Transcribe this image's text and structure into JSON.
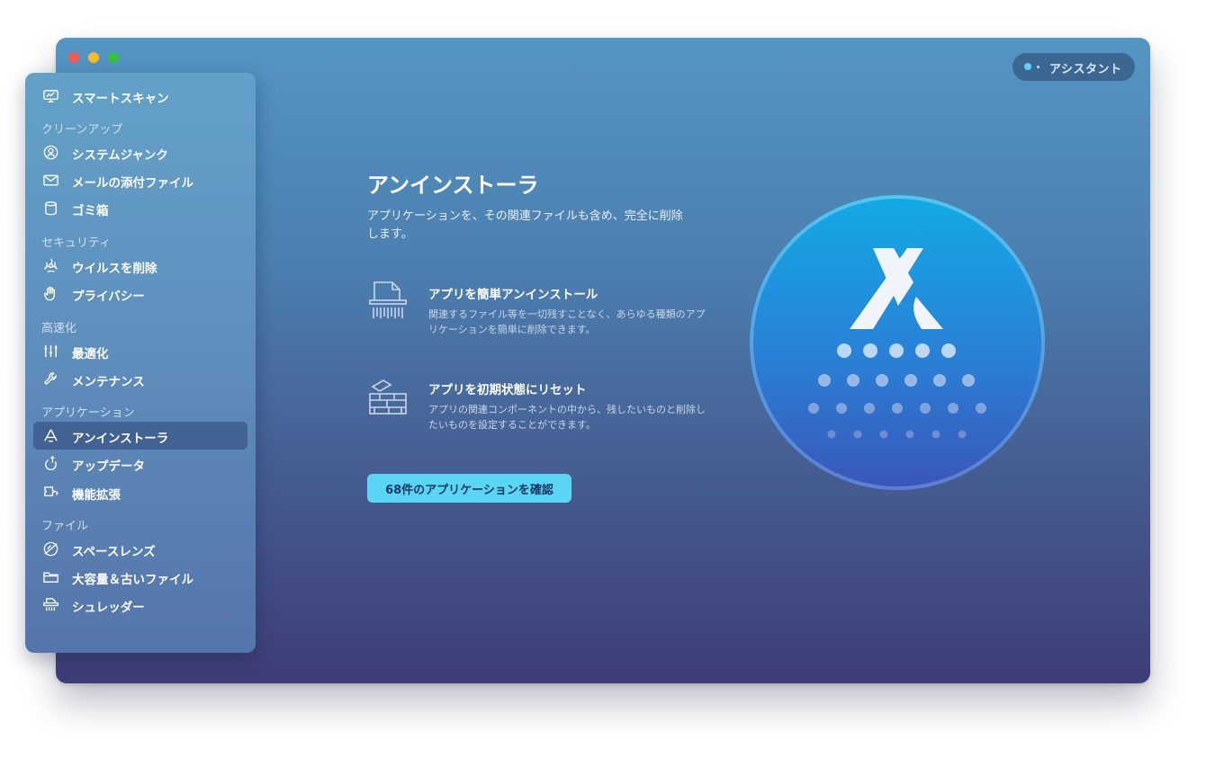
{
  "window": {
    "title": ""
  },
  "assistant": {
    "label": "アシスタント"
  },
  "sidebar": {
    "top_item": {
      "label": "スマートスキャン",
      "icon": "smart-scan-icon"
    },
    "sections": [
      {
        "heading": "クリーンアップ",
        "items": [
          {
            "label": "システムジャンク",
            "icon": "system-junk-icon"
          },
          {
            "label": "メールの添付ファイル",
            "icon": "mail-icon"
          },
          {
            "label": "ゴミ箱",
            "icon": "trash-icon"
          }
        ]
      },
      {
        "heading": "セキュリティ",
        "items": [
          {
            "label": "ウイルスを削除",
            "icon": "biohazard-icon"
          },
          {
            "label": "プライバシー",
            "icon": "hand-icon"
          }
        ]
      },
      {
        "heading": "高速化",
        "items": [
          {
            "label": "最適化",
            "icon": "sliders-icon"
          },
          {
            "label": "メンテナンス",
            "icon": "wrench-icon"
          }
        ]
      },
      {
        "heading": "アプリケーション",
        "items": [
          {
            "label": "アンインストーラ",
            "icon": "uninstaller-icon",
            "active": true
          },
          {
            "label": "アップデータ",
            "icon": "updater-icon"
          },
          {
            "label": "機能拡張",
            "icon": "extensions-icon"
          }
        ]
      },
      {
        "heading": "ファイル",
        "items": [
          {
            "label": "スペースレンズ",
            "icon": "space-lens-icon"
          },
          {
            "label": "大容量＆古いファイル",
            "icon": "folder-icon"
          },
          {
            "label": "シュレッダー",
            "icon": "shredder-icon"
          }
        ]
      }
    ]
  },
  "main": {
    "title": "アンインストーラ",
    "description": "アプリケーションを、その関連ファイルも含め、完全に削除します。",
    "features": [
      {
        "title": "アプリを簡単アンインストール",
        "description": "関連するファイル等を一切残すことなく、あらゆる種類のアプリケーションを簡単に削除できます。",
        "icon": "document-shred-icon"
      },
      {
        "title": "アプリを初期状態にリセット",
        "description": "アプリの関連コンポーネントの中から、残したいものと削除したいものを設定することができます。",
        "icon": "brick-wall-icon"
      }
    ],
    "cta_label": "68件のアプリケーションを確認",
    "hero_icon": "uninstaller-hero-icon"
  },
  "colors": {
    "accent": "#5ad5f4",
    "hero_top": "#13a9e6",
    "hero_bottom": "#3a57bb",
    "sidebar_active": "#2c4676"
  }
}
